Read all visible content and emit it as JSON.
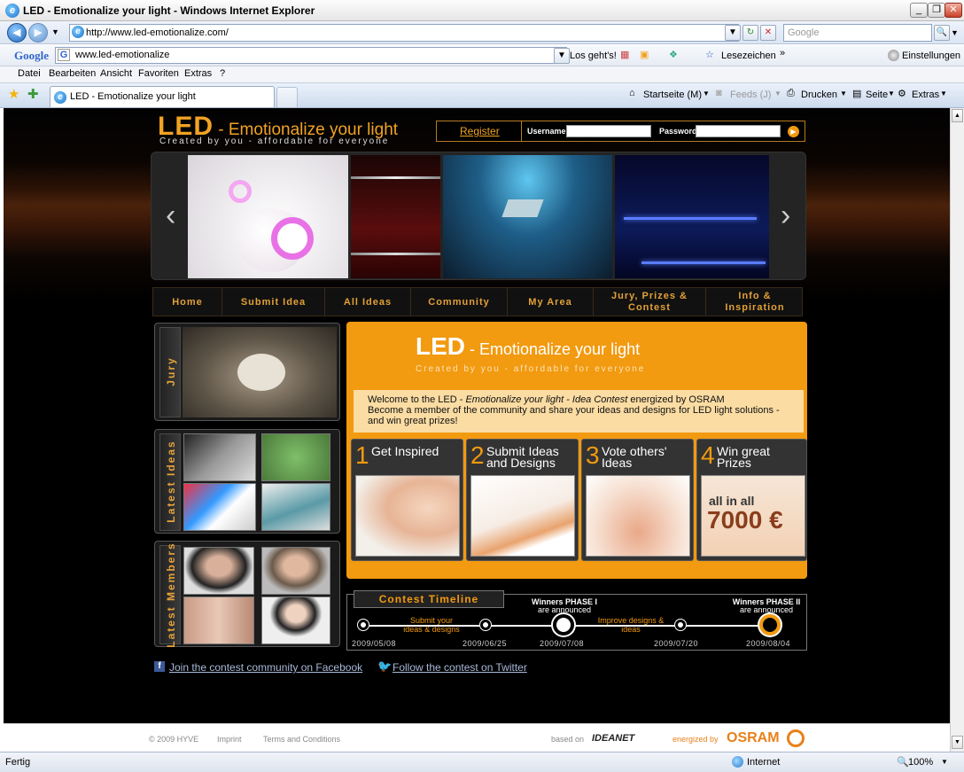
{
  "window": {
    "title": "LED - Emotionalize your light - Windows Internet Explorer"
  },
  "address": {
    "url": "http://www.led-emotionalize.com/",
    "search_placeholder": "Google"
  },
  "google_bar": {
    "brand": "Google",
    "query": "www.led-emotionalize",
    "go_label": "Los geht's!",
    "bookmarks_label": "Lesezeichen",
    "settings_label": "Einstellungen"
  },
  "menu": [
    "Datei",
    "Bearbeiten",
    "Ansicht",
    "Favoriten",
    "Extras",
    "?"
  ],
  "tab": {
    "title": "LED - Emotionalize your light"
  },
  "commands": {
    "home": "Startseite (M)",
    "feeds": "Feeds (J)",
    "print": "Drucken",
    "page": "Seite",
    "tools": "Extras"
  },
  "site": {
    "logo": {
      "led": "LED",
      "rest": " - Emotionalize your light",
      "sub": "Created by you - affordable for everyone"
    },
    "login": {
      "register": "Register",
      "username_label": "Username",
      "password_label": "Password"
    },
    "nav": [
      "Home",
      "Submit Idea",
      "All Ideas",
      "Community",
      "My Area",
      "Jury, Prizes & Contest",
      "Info & Inspiration"
    ],
    "side": {
      "jury": "Jury",
      "latest_ideas": "Latest Ideas",
      "latest_members": "Latest Members"
    },
    "main": {
      "logo_led": "LED",
      "logo_rest": " - Emotionalize your light",
      "logo_sub": "Created by you - affordable for everyone",
      "welcome_pre": "Welcome to the LED - ",
      "welcome_em": "Emotionalize your light - Idea Contest",
      "welcome_post": " energized by OSRAM",
      "welcome_line2": "Become a member of the community and share your ideas and designs for LED light solutions -",
      "welcome_line3": "and win great prizes!"
    },
    "steps": [
      {
        "num": "1",
        "label": "Get Inspired"
      },
      {
        "num": "2",
        "label": "Submit Ideas and Designs"
      },
      {
        "num": "3",
        "label": "Vote others' Ideas"
      },
      {
        "num": "4",
        "label": "Win great Prizes"
      }
    ],
    "prize_text": {
      "line1": "all in all",
      "line2": "7000 €"
    },
    "timeline": {
      "title": "Contest Timeline",
      "win1_title": "Winners PHASE I",
      "win1_sub": "are announced",
      "win2_title": "Winners PHASE II",
      "win2_sub": "are announced",
      "phase1": "Submit your ideas & designs",
      "phase2": "Improve designs & ideas",
      "dates": [
        "2009/05/08",
        "2009/06/25",
        "2009/07/08",
        "2009/07/20",
        "2009/08/04"
      ]
    },
    "social": {
      "facebook": "Join the contest community on Facebook",
      "twitter": "Follow the contest on Twitter"
    },
    "footer": {
      "copyright": "© 2009 HYVE",
      "imprint": "Imprint",
      "terms": "Terms and Conditions",
      "based_on": "based on",
      "ideanet": "IDEANET",
      "energized": "energized by",
      "osram": "OSRAM"
    }
  },
  "status": {
    "left": "Fertig",
    "zone": "Internet",
    "zoom": "100%"
  }
}
